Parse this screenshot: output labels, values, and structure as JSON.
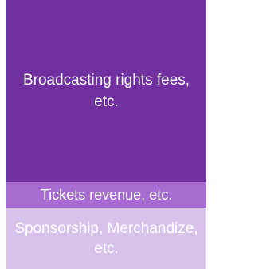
{
  "segments": [
    {
      "label": "Broadcasting rights fees, etc.",
      "color": "#7030A0"
    },
    {
      "label": "Tickets revenue, etc.",
      "color": "#A76BD1"
    },
    {
      "label": "Sponsorship, Merchandize, etc.",
      "color": "#D9C2EC"
    }
  ]
}
